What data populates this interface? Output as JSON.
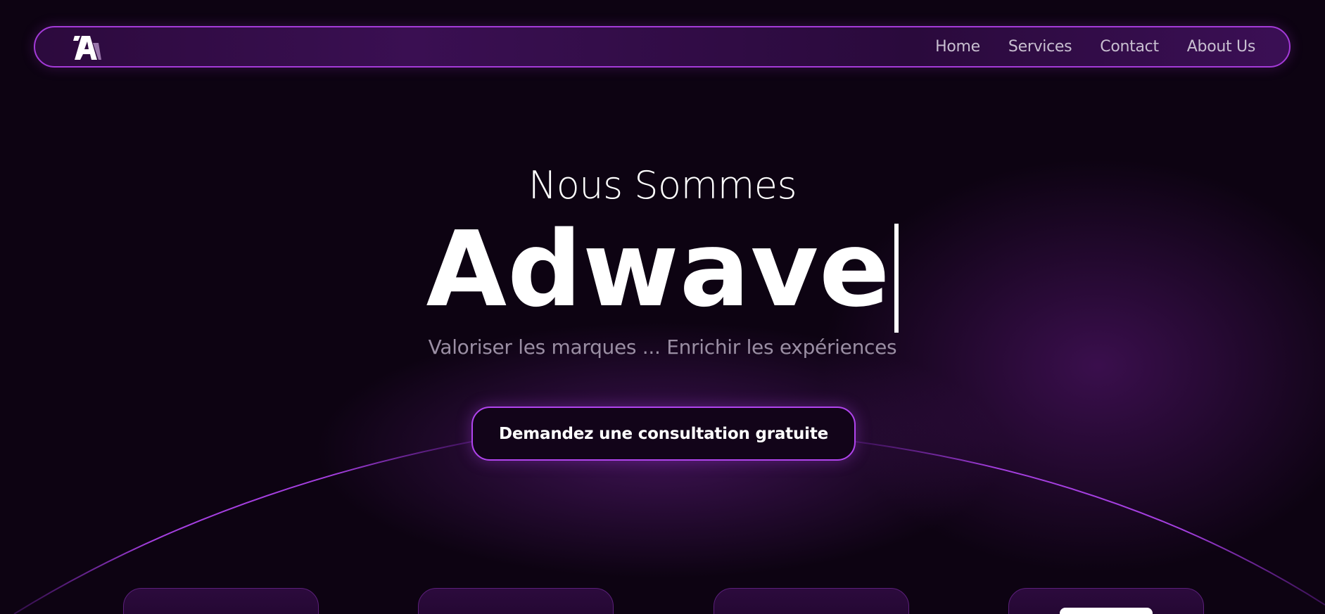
{
  "brand": {
    "logo_icon": "adwave-logo-icon"
  },
  "nav": {
    "items": [
      {
        "label": "Home"
      },
      {
        "label": "Services"
      },
      {
        "label": "Contact"
      },
      {
        "label": "About Us"
      }
    ]
  },
  "hero": {
    "pre_title": "Nous Sommes",
    "title": "Adwave",
    "subtitle": "Valoriser les marques ... Enrichir les expériences"
  },
  "cta": {
    "label": "Demandez une consultation gratuite"
  },
  "colors": {
    "background": "#0d0312",
    "accent": "#a43ad8",
    "nav_text": "#c8bfd0",
    "subtitle_text": "#9a8ea3"
  }
}
